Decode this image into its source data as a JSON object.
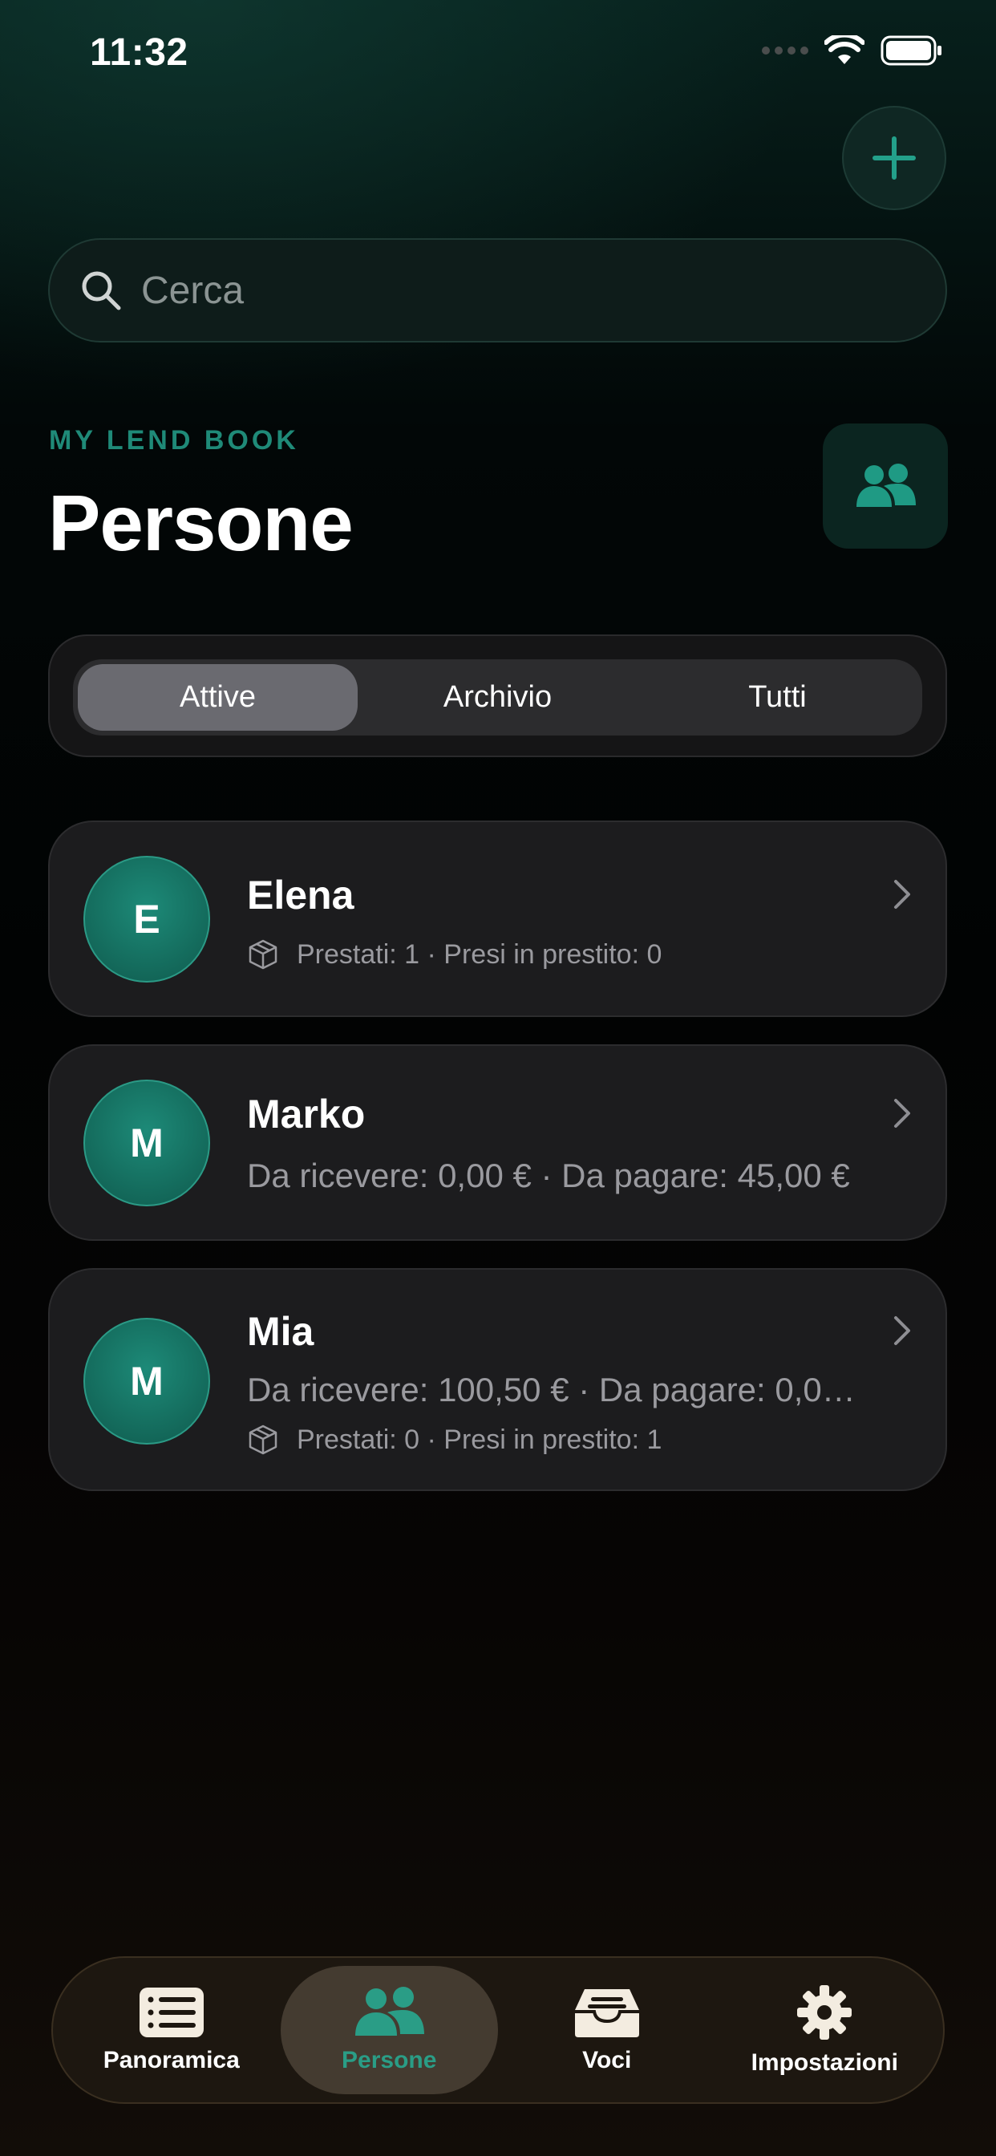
{
  "status_bar": {
    "time": "11:32"
  },
  "search": {
    "placeholder": "Cerca"
  },
  "header": {
    "kicker": "MY LEND BOOK",
    "title": "Persone"
  },
  "segments": [
    {
      "label": "Attive",
      "selected": true
    },
    {
      "label": "Archivio",
      "selected": false
    },
    {
      "label": "Tutti",
      "selected": false
    }
  ],
  "people": [
    {
      "initial": "E",
      "name": "Elena",
      "items": "Prestati: 1 · Presi in prestito: 0"
    },
    {
      "initial": "M",
      "name": "Marko",
      "amounts": "Da ricevere: 0,00 € · Da pagare: 45,00 €"
    },
    {
      "initial": "M",
      "name": "Mia",
      "amounts": "Da ricevere: 100,50 € · Da pagare: 0,0…",
      "items": "Prestati: 0 · Presi in prestito: 1"
    }
  ],
  "tab_bar": [
    {
      "label": "Panoramica",
      "icon": "list-icon",
      "selected": false
    },
    {
      "label": "Persone",
      "icon": "people-icon",
      "selected": true
    },
    {
      "label": "Voci",
      "icon": "tray-icon",
      "selected": false
    },
    {
      "label": "Impostazioni",
      "icon": "gear-icon",
      "selected": false
    }
  ],
  "colors": {
    "accent": "#1f8a78",
    "active_tab_text": "#2a9d86",
    "card": "#1c1c1e"
  }
}
